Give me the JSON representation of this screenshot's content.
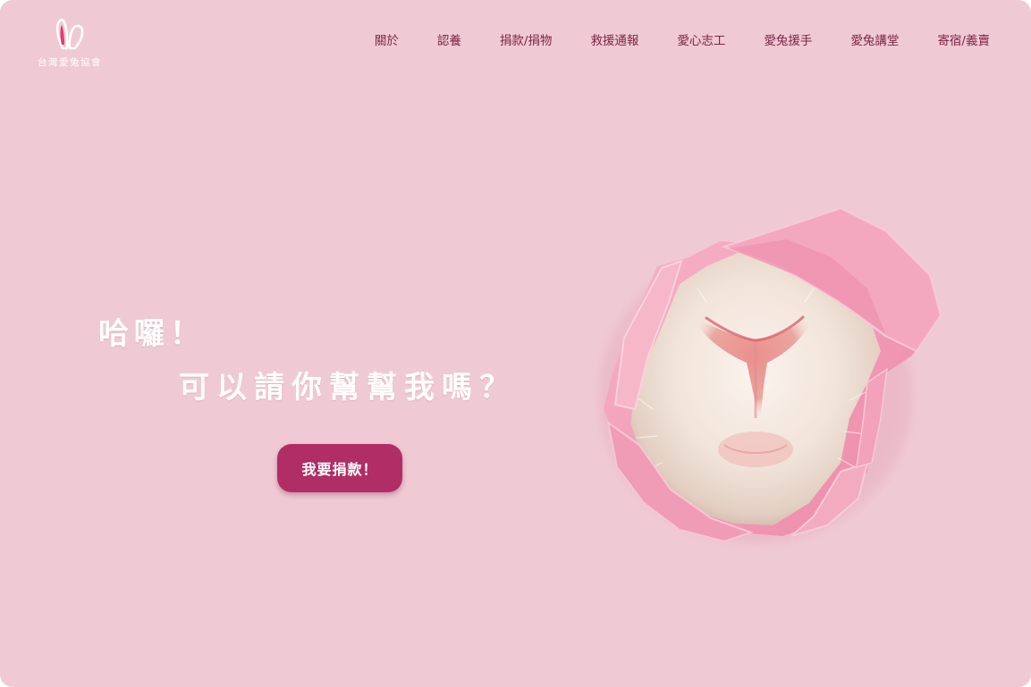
{
  "brand": {
    "name": "台灣愛兔協會",
    "logo_icon": "bunny-ears-icon"
  },
  "nav": {
    "items": [
      {
        "label": "關於"
      },
      {
        "label": "認養"
      },
      {
        "label": "捐款/捐物"
      },
      {
        "label": "救援通報"
      },
      {
        "label": "愛心志工"
      },
      {
        "label": "愛兔援手"
      },
      {
        "label": "愛兔講堂"
      },
      {
        "label": "寄宿/義賣"
      }
    ]
  },
  "hero": {
    "greeting": "哈囉！",
    "question": "可以請你幫幫我嗎？",
    "cta_label": "我要捐款！",
    "image_icon": "bunny-nose-torn-paper-image"
  },
  "colors": {
    "background": "#efcad4",
    "accent": "#b02d66",
    "nav_text": "#7d2346",
    "headline_text": "#ffffff"
  }
}
